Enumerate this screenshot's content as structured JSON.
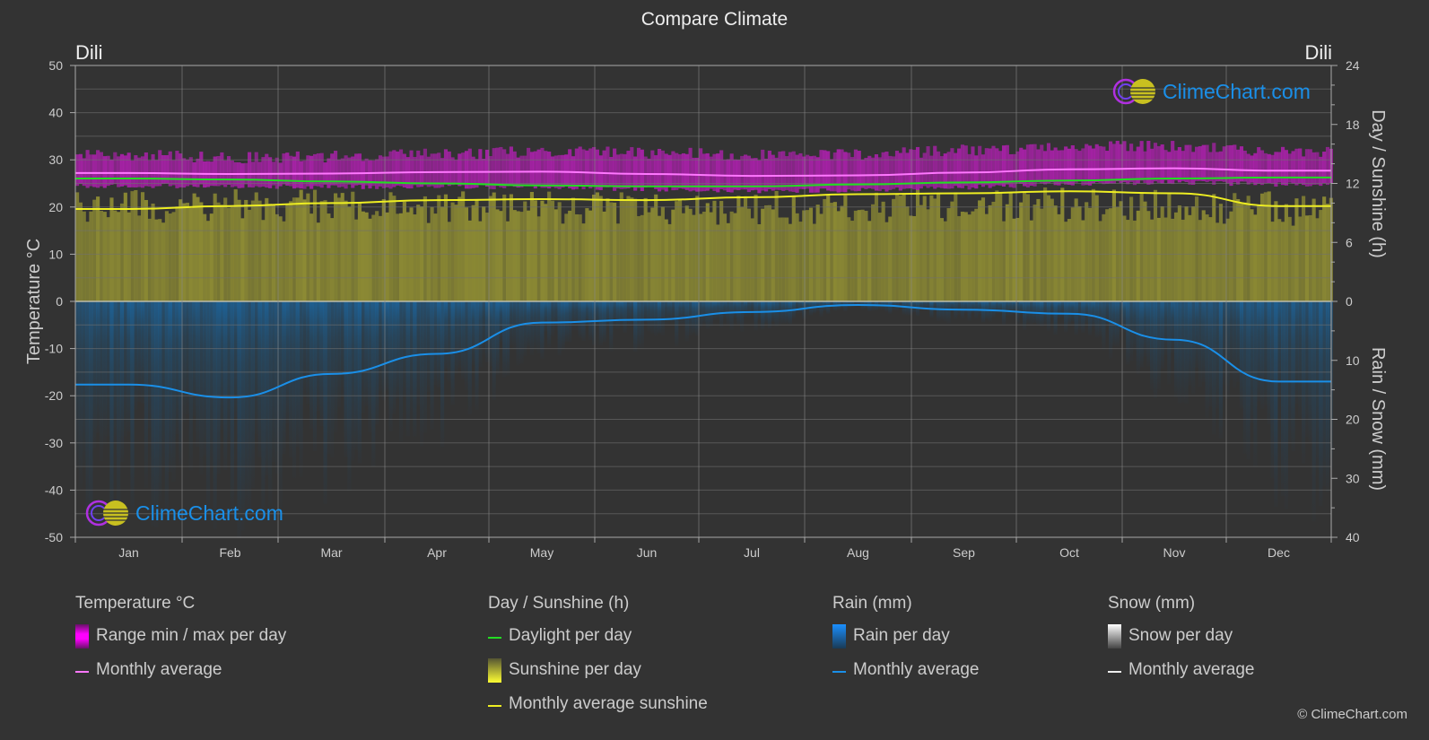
{
  "title": "Compare Climate",
  "location_left": "Dili",
  "location_right": "Dili",
  "logo_text": "ClimeChart.com",
  "copyright": "© ClimeChart.com",
  "colors": {
    "background": "#333333",
    "temp_range": "#c61dc6",
    "temp_avg": "#ff77ff",
    "daylight": "#22dd22",
    "sunshine_fill": "#8c8a34",
    "sunshine_avg": "#eeee22",
    "rain_fill": "#1a5f91",
    "rain_avg": "#1a8fe8",
    "grid": "#5a5a5a"
  },
  "chart_data": {
    "type": "area",
    "title": "Compare Climate",
    "categories": [
      "Jan",
      "Feb",
      "Mar",
      "Apr",
      "May",
      "Jun",
      "Jul",
      "Aug",
      "Sep",
      "Oct",
      "Nov",
      "Dec"
    ],
    "left_axis": {
      "label": "Temperature °C",
      "ylim": [
        -50,
        50
      ],
      "ticks": [
        50,
        40,
        30,
        20,
        10,
        0,
        -10,
        -20,
        -30,
        -40,
        -50
      ]
    },
    "right_axis_top": {
      "label": "Day / Sunshine (h)",
      "ylim": [
        0,
        24
      ],
      "ticks": [
        24,
        18,
        12,
        6,
        0
      ]
    },
    "right_axis_bottom": {
      "label": "Rain / Snow (mm)",
      "ylim": [
        0,
        40
      ],
      "ticks": [
        0,
        10,
        20,
        30,
        40
      ]
    },
    "grid": true,
    "series": [
      {
        "name": "Temperature range min",
        "unit": "°C",
        "values": [
          24.5,
          24.4,
          24.3,
          24.3,
          24.2,
          23.8,
          23.4,
          23.6,
          24.2,
          24.9,
          25.2,
          24.8
        ]
      },
      {
        "name": "Temperature range max",
        "unit": "°C",
        "values": [
          31.0,
          30.5,
          30.7,
          31.2,
          31.8,
          31.5,
          31.0,
          31.2,
          32.0,
          32.8,
          32.9,
          31.8
        ]
      },
      {
        "name": "Temperature monthly average",
        "unit": "°C",
        "values": [
          27.2,
          27.0,
          27.1,
          27.4,
          27.5,
          27.0,
          26.6,
          26.7,
          27.3,
          28.0,
          28.2,
          27.7
        ]
      },
      {
        "name": "Daylight per day",
        "unit": "h",
        "values": [
          12.5,
          12.4,
          12.2,
          12.0,
          11.8,
          11.7,
          11.7,
          11.9,
          12.1,
          12.3,
          12.5,
          12.6
        ]
      },
      {
        "name": "Sunshine per day",
        "unit": "h",
        "values": [
          11.5,
          11.4,
          11.4,
          11.3,
          11.2,
          11.1,
          11.2,
          11.5,
          11.6,
          11.6,
          11.5,
          11.2
        ]
      },
      {
        "name": "Monthly average sunshine",
        "unit": "h",
        "values": [
          9.4,
          9.7,
          10.0,
          10.3,
          10.4,
          10.3,
          10.6,
          10.9,
          11.0,
          11.2,
          11.0,
          9.7
        ]
      },
      {
        "name": "Rain monthly average",
        "unit": "mm",
        "values": [
          14.1,
          16.3,
          12.3,
          8.9,
          3.6,
          3.1,
          1.8,
          0.6,
          1.4,
          2.1,
          6.5,
          13.6
        ]
      },
      {
        "name": "Snow monthly average",
        "unit": "mm",
        "values": [
          0,
          0,
          0,
          0,
          0,
          0,
          0,
          0,
          0,
          0,
          0,
          0
        ]
      }
    ]
  },
  "legend": {
    "temperature": {
      "title": "Temperature °C",
      "items": [
        "Range min / max per day",
        "Monthly average"
      ]
    },
    "sunshine": {
      "title": "Day / Sunshine (h)",
      "items": [
        "Daylight per day",
        "Sunshine per day",
        "Monthly average sunshine"
      ]
    },
    "rain": {
      "title": "Rain (mm)",
      "items": [
        "Rain per day",
        "Monthly average"
      ]
    },
    "snow": {
      "title": "Snow (mm)",
      "items": [
        "Snow per day",
        "Monthly average"
      ]
    }
  }
}
